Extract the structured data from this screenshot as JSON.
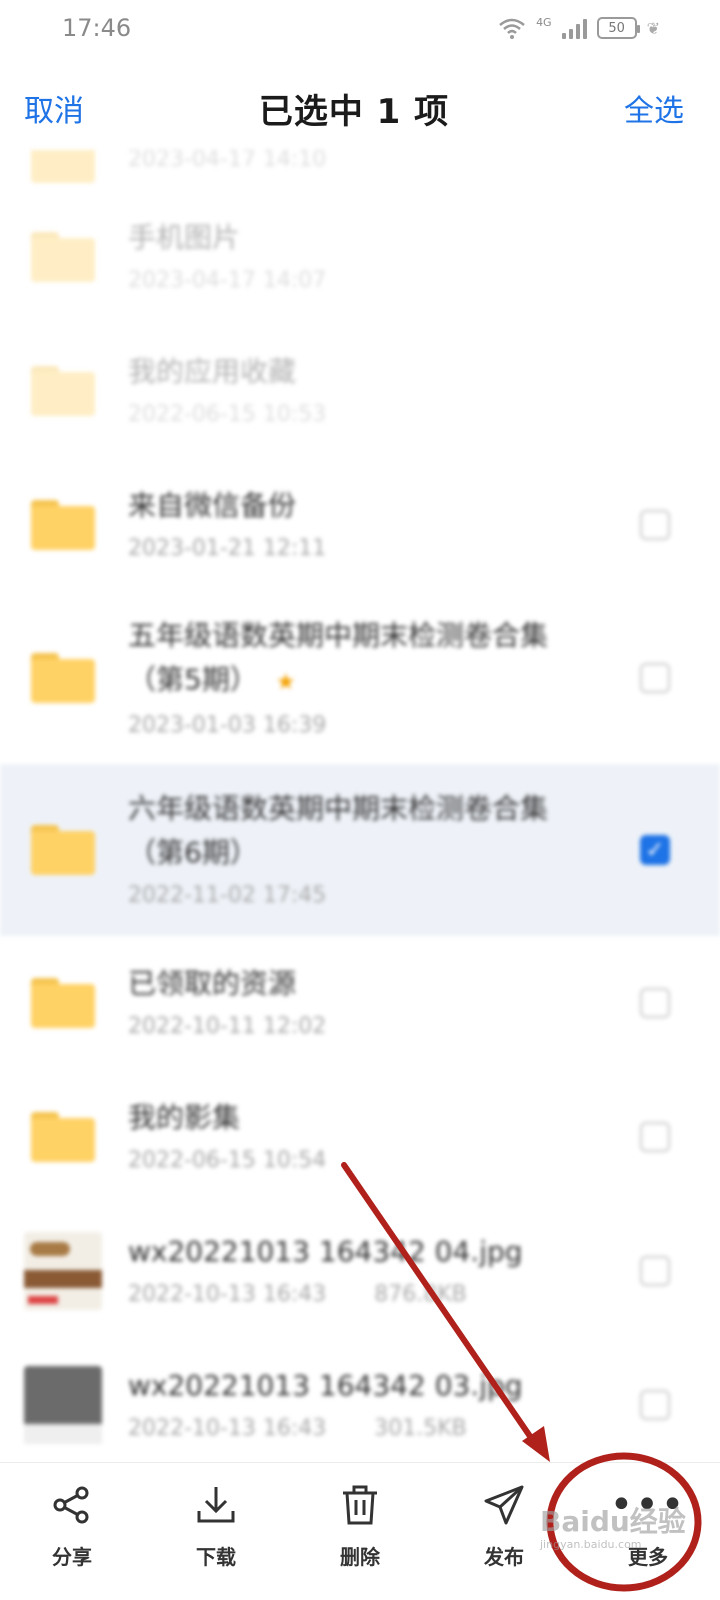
{
  "status_bar": {
    "time": "17:46",
    "network": "4G",
    "battery": "50"
  },
  "header": {
    "cancel_label": "取消",
    "title": "已选中 1 项",
    "select_all_label": "全选"
  },
  "files": [
    {
      "name": "",
      "date": "2023-04-17 14:10",
      "type": "folder",
      "faded": true,
      "show_checkbox": false,
      "checked": false
    },
    {
      "name": "手机图片",
      "date": "2023-04-17 14:07",
      "type": "folder",
      "faded": true,
      "show_checkbox": false,
      "checked": false
    },
    {
      "name": "我的应用收藏",
      "date": "2022-06-15 10:53",
      "type": "folder",
      "faded": true,
      "show_checkbox": false,
      "checked": false
    },
    {
      "name": "来自微信备份",
      "date": "2023-01-21 12:11",
      "type": "folder",
      "faded": false,
      "show_checkbox": true,
      "checked": false
    },
    {
      "name": "五年级语数英期中期末检测卷合集",
      "name2": "（第5期）",
      "starred": true,
      "date": "2023-01-03 16:39",
      "type": "folder",
      "faded": false,
      "show_checkbox": true,
      "checked": false
    },
    {
      "name": "六年级语数英期中期末检测卷合集",
      "name2": "（第6期）",
      "date": "2022-11-02 17:45",
      "type": "folder",
      "faded": false,
      "show_checkbox": true,
      "checked": true
    },
    {
      "name": "已领取的资源",
      "date": "2022-10-11 12:02",
      "type": "folder",
      "faded": false,
      "show_checkbox": true,
      "checked": false
    },
    {
      "name": "我的影集",
      "date": "2022-06-15 10:54",
      "type": "folder",
      "faded": false,
      "show_checkbox": true,
      "checked": false
    },
    {
      "name": "wx20221013 164342 04.jpg",
      "date": "2022-10-13 16:43",
      "size": "876.8KB",
      "type": "image",
      "faded": false,
      "show_checkbox": true,
      "checked": false
    },
    {
      "name": "wx20221013 164342 03.jpg",
      "date": "2022-10-13 16:43",
      "size": "301.5KB",
      "type": "image",
      "faded": false,
      "show_checkbox": true,
      "checked": false
    }
  ],
  "toolbar": {
    "items": [
      {
        "label": "分享",
        "icon": "share-icon"
      },
      {
        "label": "下载",
        "icon": "download-icon"
      },
      {
        "label": "删除",
        "icon": "trash-icon"
      },
      {
        "label": "发布",
        "icon": "send-icon"
      },
      {
        "label": "更多",
        "icon": "more-icon"
      }
    ]
  },
  "watermark": {
    "text": "Baidu经验",
    "sub": "jingyan.baidu.com"
  },
  "colors": {
    "accent": "#1e73e6",
    "folder": "#ffd266",
    "annotation": "#b0211c"
  }
}
